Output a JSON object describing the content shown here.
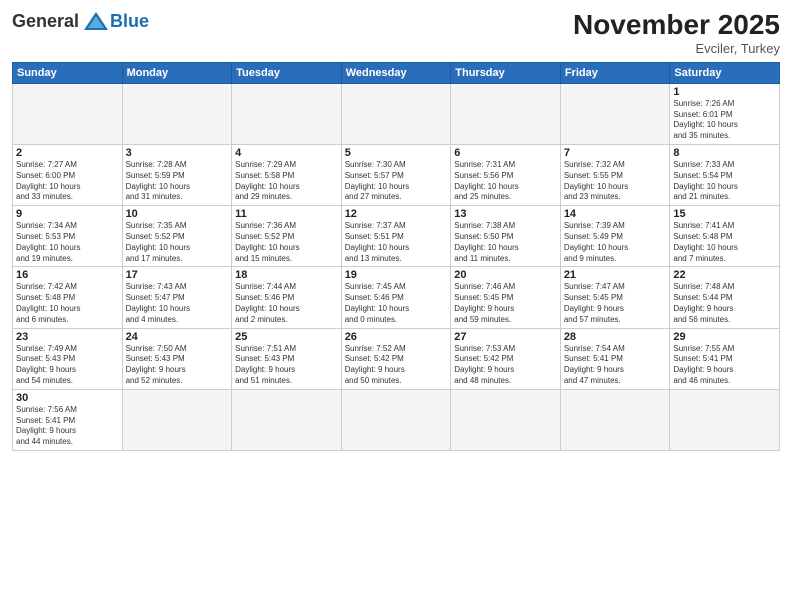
{
  "logo": {
    "general": "General",
    "blue": "Blue"
  },
  "title": "November 2025",
  "subtitle": "Evciler, Turkey",
  "headers": [
    "Sunday",
    "Monday",
    "Tuesday",
    "Wednesday",
    "Thursday",
    "Friday",
    "Saturday"
  ],
  "weeks": [
    [
      {
        "day": "",
        "info": ""
      },
      {
        "day": "",
        "info": ""
      },
      {
        "day": "",
        "info": ""
      },
      {
        "day": "",
        "info": ""
      },
      {
        "day": "",
        "info": ""
      },
      {
        "day": "",
        "info": ""
      },
      {
        "day": "1",
        "info": "Sunrise: 7:26 AM\nSunset: 6:01 PM\nDaylight: 10 hours\nand 35 minutes."
      }
    ],
    [
      {
        "day": "2",
        "info": "Sunrise: 7:27 AM\nSunset: 6:00 PM\nDaylight: 10 hours\nand 33 minutes."
      },
      {
        "day": "3",
        "info": "Sunrise: 7:28 AM\nSunset: 5:59 PM\nDaylight: 10 hours\nand 31 minutes."
      },
      {
        "day": "4",
        "info": "Sunrise: 7:29 AM\nSunset: 5:58 PM\nDaylight: 10 hours\nand 29 minutes."
      },
      {
        "day": "5",
        "info": "Sunrise: 7:30 AM\nSunset: 5:57 PM\nDaylight: 10 hours\nand 27 minutes."
      },
      {
        "day": "6",
        "info": "Sunrise: 7:31 AM\nSunset: 5:56 PM\nDaylight: 10 hours\nand 25 minutes."
      },
      {
        "day": "7",
        "info": "Sunrise: 7:32 AM\nSunset: 5:55 PM\nDaylight: 10 hours\nand 23 minutes."
      },
      {
        "day": "8",
        "info": "Sunrise: 7:33 AM\nSunset: 5:54 PM\nDaylight: 10 hours\nand 21 minutes."
      }
    ],
    [
      {
        "day": "9",
        "info": "Sunrise: 7:34 AM\nSunset: 5:53 PM\nDaylight: 10 hours\nand 19 minutes."
      },
      {
        "day": "10",
        "info": "Sunrise: 7:35 AM\nSunset: 5:52 PM\nDaylight: 10 hours\nand 17 minutes."
      },
      {
        "day": "11",
        "info": "Sunrise: 7:36 AM\nSunset: 5:52 PM\nDaylight: 10 hours\nand 15 minutes."
      },
      {
        "day": "12",
        "info": "Sunrise: 7:37 AM\nSunset: 5:51 PM\nDaylight: 10 hours\nand 13 minutes."
      },
      {
        "day": "13",
        "info": "Sunrise: 7:38 AM\nSunset: 5:50 PM\nDaylight: 10 hours\nand 11 minutes."
      },
      {
        "day": "14",
        "info": "Sunrise: 7:39 AM\nSunset: 5:49 PM\nDaylight: 10 hours\nand 9 minutes."
      },
      {
        "day": "15",
        "info": "Sunrise: 7:41 AM\nSunset: 5:48 PM\nDaylight: 10 hours\nand 7 minutes."
      }
    ],
    [
      {
        "day": "16",
        "info": "Sunrise: 7:42 AM\nSunset: 5:48 PM\nDaylight: 10 hours\nand 6 minutes."
      },
      {
        "day": "17",
        "info": "Sunrise: 7:43 AM\nSunset: 5:47 PM\nDaylight: 10 hours\nand 4 minutes."
      },
      {
        "day": "18",
        "info": "Sunrise: 7:44 AM\nSunset: 5:46 PM\nDaylight: 10 hours\nand 2 minutes."
      },
      {
        "day": "19",
        "info": "Sunrise: 7:45 AM\nSunset: 5:46 PM\nDaylight: 10 hours\nand 0 minutes."
      },
      {
        "day": "20",
        "info": "Sunrise: 7:46 AM\nSunset: 5:45 PM\nDaylight: 9 hours\nand 59 minutes."
      },
      {
        "day": "21",
        "info": "Sunrise: 7:47 AM\nSunset: 5:45 PM\nDaylight: 9 hours\nand 57 minutes."
      },
      {
        "day": "22",
        "info": "Sunrise: 7:48 AM\nSunset: 5:44 PM\nDaylight: 9 hours\nand 56 minutes."
      }
    ],
    [
      {
        "day": "23",
        "info": "Sunrise: 7:49 AM\nSunset: 5:43 PM\nDaylight: 9 hours\nand 54 minutes."
      },
      {
        "day": "24",
        "info": "Sunrise: 7:50 AM\nSunset: 5:43 PM\nDaylight: 9 hours\nand 52 minutes."
      },
      {
        "day": "25",
        "info": "Sunrise: 7:51 AM\nSunset: 5:43 PM\nDaylight: 9 hours\nand 51 minutes."
      },
      {
        "day": "26",
        "info": "Sunrise: 7:52 AM\nSunset: 5:42 PM\nDaylight: 9 hours\nand 50 minutes."
      },
      {
        "day": "27",
        "info": "Sunrise: 7:53 AM\nSunset: 5:42 PM\nDaylight: 9 hours\nand 48 minutes."
      },
      {
        "day": "28",
        "info": "Sunrise: 7:54 AM\nSunset: 5:41 PM\nDaylight: 9 hours\nand 47 minutes."
      },
      {
        "day": "29",
        "info": "Sunrise: 7:55 AM\nSunset: 5:41 PM\nDaylight: 9 hours\nand 46 minutes."
      }
    ],
    [
      {
        "day": "30",
        "info": "Sunrise: 7:56 AM\nSunset: 5:41 PM\nDaylight: 9 hours\nand 44 minutes."
      },
      {
        "day": "",
        "info": ""
      },
      {
        "day": "",
        "info": ""
      },
      {
        "day": "",
        "info": ""
      },
      {
        "day": "",
        "info": ""
      },
      {
        "day": "",
        "info": ""
      },
      {
        "day": "",
        "info": ""
      }
    ]
  ]
}
